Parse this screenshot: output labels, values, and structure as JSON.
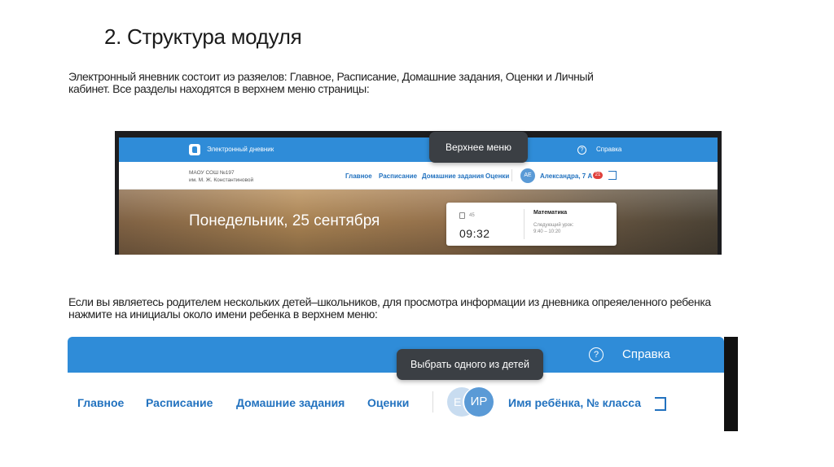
{
  "slide": {
    "title": "2. Структура модуля",
    "paragraph1": "Электронный яневник состоит иэ разяелов: Главное, Расписание, Домашние задания, Оценки и  Личный кабинет. Все разделы находятся в верхнем меню страницы:",
    "paragraph2": "Если вы являетесь родителем нескольких детей–школьников, для просмотра информации из дневника опреяеленного ребенка нажмите на инициалы около имени ребенка в верхнем меню:"
  },
  "shot1": {
    "app_name": "Электронный дневник",
    "help_label": "Справка",
    "school_line1": "МАОУ СОШ №197",
    "school_line2": "им. М. Ж. Константиновой",
    "tabs": [
      {
        "label": "Главное"
      },
      {
        "label": "Расписание"
      },
      {
        "label": "Домашние задания"
      },
      {
        "label": "Оценки"
      }
    ],
    "avatar_initials": "АЕ",
    "child_label": "Александра, 7 А",
    "badge_count": "21",
    "hero_date": "Понедельник, 25 сентября",
    "card": {
      "lesson_no": "45",
      "time": "09:32",
      "subject": "Математика",
      "next_label": "Следующий урок:",
      "next_time": "9:40 – 10:20"
    },
    "tooltip": "Верхнее меню"
  },
  "shot2": {
    "help_label": "Справка",
    "tabs": [
      {
        "label": "Главное"
      },
      {
        "label": "Расписание"
      },
      {
        "label": "Домашние задания"
      },
      {
        "label": "Оценки"
      }
    ],
    "avatar_back_initial": "Е",
    "avatar_initials": "ИР",
    "child_label": "Имя ребёнка, № класса",
    "tooltip": "Выбрать одного из детей"
  },
  "colors": {
    "brand_blue": "#2f8cd8",
    "link_blue": "#2272bf",
    "tooltip_bg": "#3b3f44",
    "badge_red": "#e0413c"
  }
}
